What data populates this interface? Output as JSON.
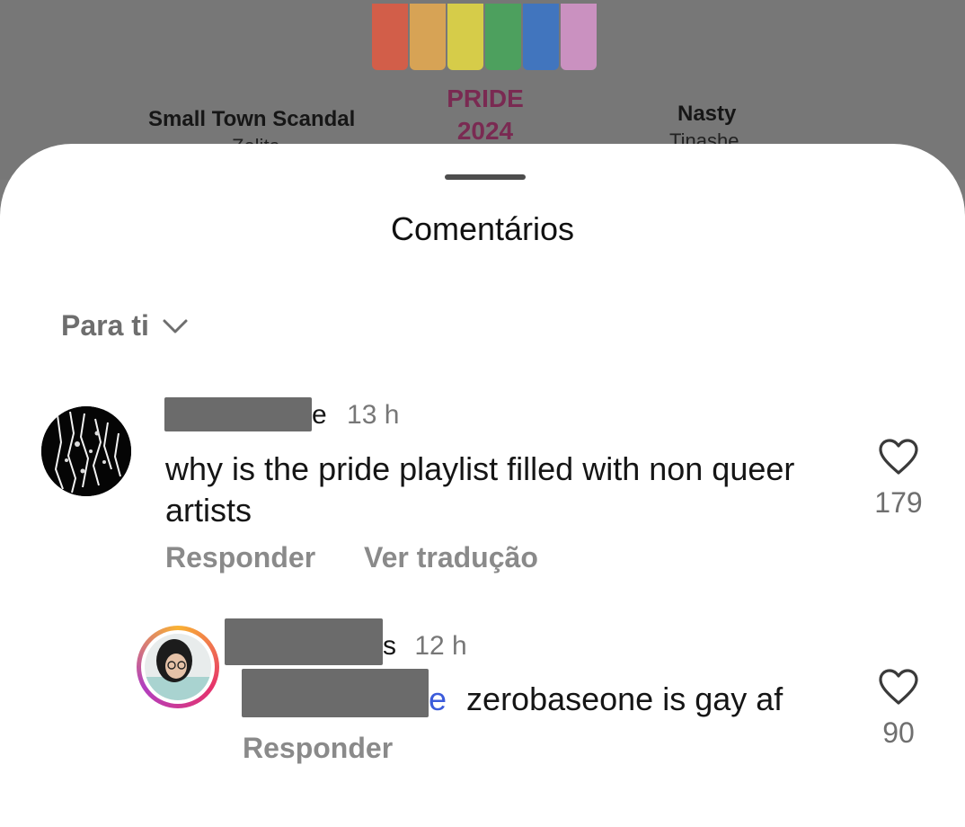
{
  "background": {
    "stripe_colors": [
      "#f0553a",
      "#f7b24a",
      "#f6e83a",
      "#3fae55",
      "#2f74d6",
      "#e59ad8"
    ],
    "left_track": {
      "title": "Small Town Scandal",
      "artist": "Zolita"
    },
    "center_playlist": {
      "line1": "PRIDE",
      "line2": "2024"
    },
    "right_track": {
      "title": "Nasty",
      "artist": "Tinashe"
    }
  },
  "sheet": {
    "title": "Comentários",
    "sort_label": "Para ti"
  },
  "comments": [
    {
      "username_suffix": "e",
      "time": "13 h",
      "text": "why is the pride playlist filled with non queer artists",
      "reply_label": "Responder",
      "translate_label": "Ver tradução",
      "likes": "179"
    }
  ],
  "replies": [
    {
      "username_suffix": "s",
      "time": "12 h",
      "mention_suffix": "e",
      "text": "zerobaseone is gay af",
      "reply_label": "Responder",
      "likes": "90"
    }
  ],
  "icons": {
    "sort": "chevron-down-icon",
    "like": "heart-outline-icon"
  }
}
